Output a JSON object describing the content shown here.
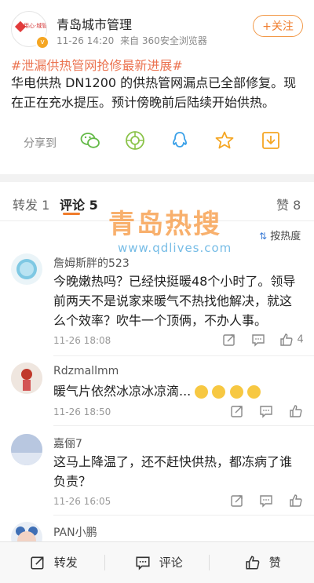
{
  "post": {
    "account_name": "青岛城市管理",
    "logo_text": "用心·城管",
    "time": "11-26 14:20",
    "source": "来自 360安全浏览器",
    "follow_label": "+关注",
    "hashtag": "#泄漏供热管网抢修最新进展#",
    "body": "华电供热 DN1200 的供热管网漏点已全部修复。现在正在充水提压。预计傍晚前后陆续开始供热。"
  },
  "share": {
    "label": "分享到",
    "icons": [
      "wechat-icon",
      "moments-icon",
      "qq-icon",
      "favorite-icon",
      "save-icon"
    ]
  },
  "tabs": {
    "repost": "转发 1",
    "comment": "评论 5",
    "like": "赞 8"
  },
  "watermark": {
    "title": "青岛热搜",
    "url": "www.qdlives.com"
  },
  "sort_label": "按热度",
  "comments": [
    {
      "name": "詹姆斯胖的523",
      "text": "今晚嫩热吗？已经快挺暖48个小时了。领导前两天不是说家来暖气不热找他解决，就这么个效率？吹牛一个顶俩，不办人事。",
      "time": "11-26 18:08",
      "likes": "4"
    },
    {
      "name": "Rdzmallmm",
      "text": "暖气片依然冰凉冰凉滴...",
      "time": "11-26 18:50",
      "likes": ""
    },
    {
      "name": "嘉俪7",
      "text": "这马上降温了，还不赶快供热，都冻病了谁负责？",
      "time": "11-26 16:05",
      "likes": ""
    },
    {
      "name": "PAN小鹏",
      "text": "",
      "time": "",
      "likes": ""
    }
  ],
  "bottom_bar": {
    "repost": "转发",
    "comment": "评论",
    "like": "赞"
  },
  "colors": {
    "accent": "#f07c2b",
    "hashtag": "#eb7350",
    "watermark": "#f5963c"
  }
}
